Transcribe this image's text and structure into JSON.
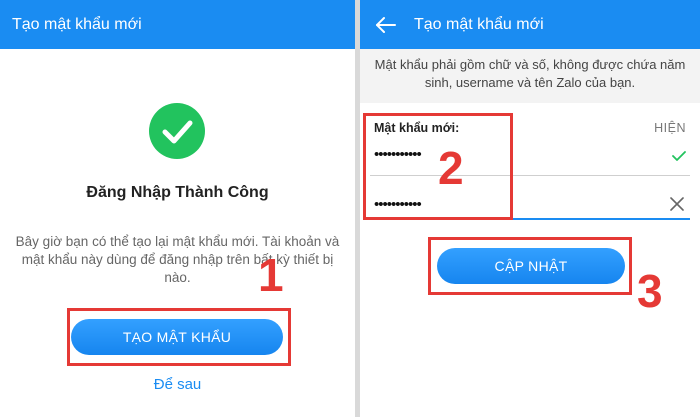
{
  "left": {
    "header_title": "Tạo mật khẩu mới",
    "success_title": "Đăng Nhập Thành Công",
    "success_desc": "Bây giờ bạn có thể tạo lại mật khẩu mới. Tài khoản và mật khẩu này dùng để đăng nhập trên bất kỳ thiết bị nào.",
    "create_button": "TẠO MẬT KHẨU",
    "later_link": "Để sau"
  },
  "right": {
    "header_title": "Tạo mật khẩu mới",
    "hint": "Mật khẩu phải gồm chữ và số, không được chứa năm sinh, username và tên Zalo của bạn.",
    "password_label": "Mật khẩu mới:",
    "show_label": "HIỆN",
    "password_value": "•••••••••••",
    "confirm_value": "•••••••••••",
    "update_button": "CẬP NHẬT"
  },
  "annotations": {
    "step1": "1",
    "step2": "2",
    "step3": "3"
  },
  "colors": {
    "header": "#1a8cf2",
    "success": "#22c35e",
    "highlight": "#e53935"
  },
  "icons": {
    "success": "check-circle-icon",
    "back": "arrow-left-icon",
    "check": "check-icon",
    "clear": "close-icon"
  }
}
